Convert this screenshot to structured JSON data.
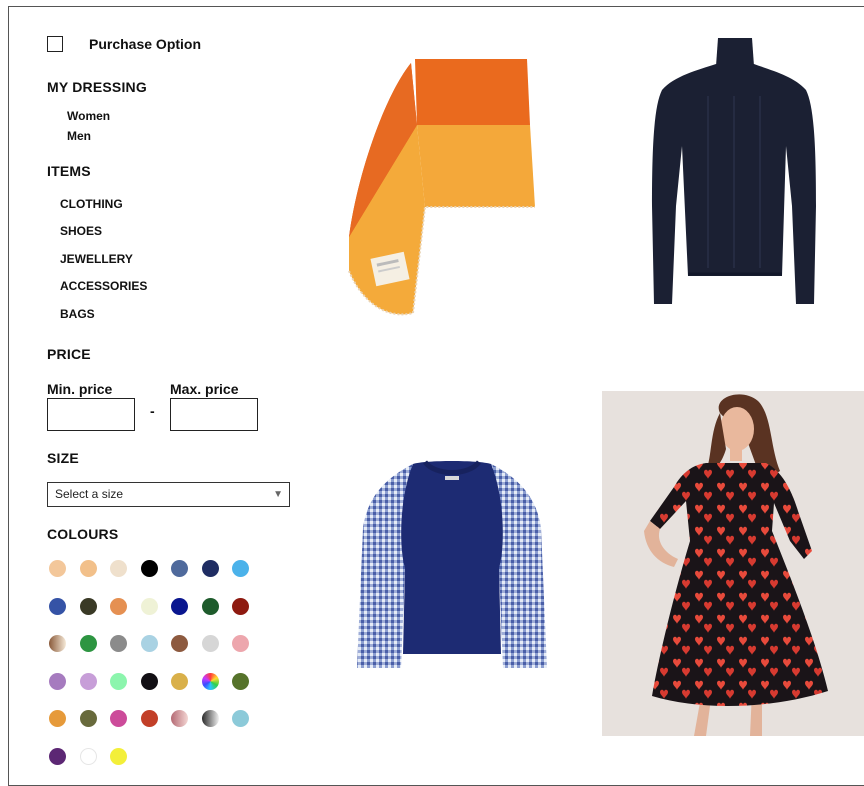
{
  "filters": {
    "purchase_option_label": "Purchase Option",
    "my_dressing": {
      "heading": "MY DRESSING",
      "items": [
        "Women",
        "Men"
      ]
    },
    "items": {
      "heading": "ITEMS",
      "links": [
        "CLOTHING",
        "SHOES",
        "JEWELLERY",
        "ACCESSORIES",
        "BAGS"
      ]
    },
    "price": {
      "heading": "PRICE",
      "min_label": "Min. price",
      "max_label": "Max. price",
      "separator": "-",
      "min_value": "",
      "max_value": ""
    },
    "size": {
      "heading": "SIZE",
      "selected": "Select a size"
    },
    "colours": {
      "heading": "COLOURS",
      "swatches": [
        "#f3c79a",
        "#f2c08a",
        "#efe0cc",
        "#000000",
        "#4f6a9c",
        "#1f2d63",
        "#4bb2ea",
        "#3553a6",
        "#3a3a26",
        "#e59052",
        "#eff2d6",
        "#0a168f",
        "#1e5b2c",
        "#8e1a10",
        "gradient-brown",
        "#2d9541",
        "#8b8b8b",
        "#a9d2e3",
        "#8d5a3f",
        "#d6d6d6",
        "#eda6ad",
        "#a67bbf",
        "#c79ed8",
        "#8cf5ad",
        "#120f14",
        "#d9b04a",
        "rainbow",
        "#56732b",
        "#e69a3a",
        "#686a3c",
        "#cc4b9a",
        "#c23f28",
        "gradient-rose",
        "gradient-grey",
        "#8ccad9",
        "#5c2774",
        "#ffffff",
        "#f3ef3a"
      ]
    }
  },
  "products": [
    {
      "name": "orange-yellow-asymmetric-skirt"
    },
    {
      "name": "navy-turtleneck-sweater"
    },
    {
      "name": "blue-gingham-sleeve-sweater"
    },
    {
      "name": "red-heart-print-dress"
    }
  ]
}
